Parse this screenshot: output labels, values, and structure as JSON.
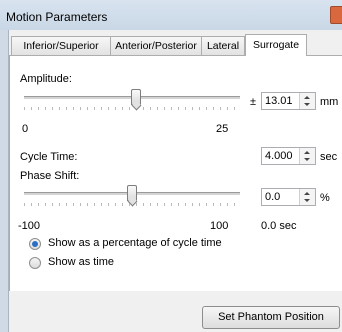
{
  "window": {
    "title": "Motion Parameters",
    "close_icon": "close-icon"
  },
  "tabs": [
    {
      "label": "Inferior/Superior",
      "active": false
    },
    {
      "label": "Anterior/Posterior",
      "active": false
    },
    {
      "label": "Lateral",
      "active": false
    },
    {
      "label": "Surrogate",
      "active": true
    }
  ],
  "amplitude": {
    "label": "Amplitude:",
    "min_label": "0",
    "max_label": "25",
    "prefix": "±",
    "value": "13.01",
    "unit": "mm",
    "slider_level": 0.52
  },
  "cycle_time": {
    "label": "Cycle Time:",
    "value": "4.000",
    "unit": "sec"
  },
  "phase_shift": {
    "label": "Phase Shift:",
    "min_label": "-100",
    "max_label": "100",
    "value": "0.0",
    "unit": "%",
    "time_readout": "0.0 sec",
    "slider_level": 0.5
  },
  "options": [
    {
      "label": "Show as a percentage of cycle time",
      "selected": true
    },
    {
      "label": "Show as time",
      "selected": false
    }
  ],
  "set_phantom_button": "Set Phantom Position",
  "colors": {
    "selected_radio": "#2a6ec4",
    "close_button": "#d9683f"
  }
}
